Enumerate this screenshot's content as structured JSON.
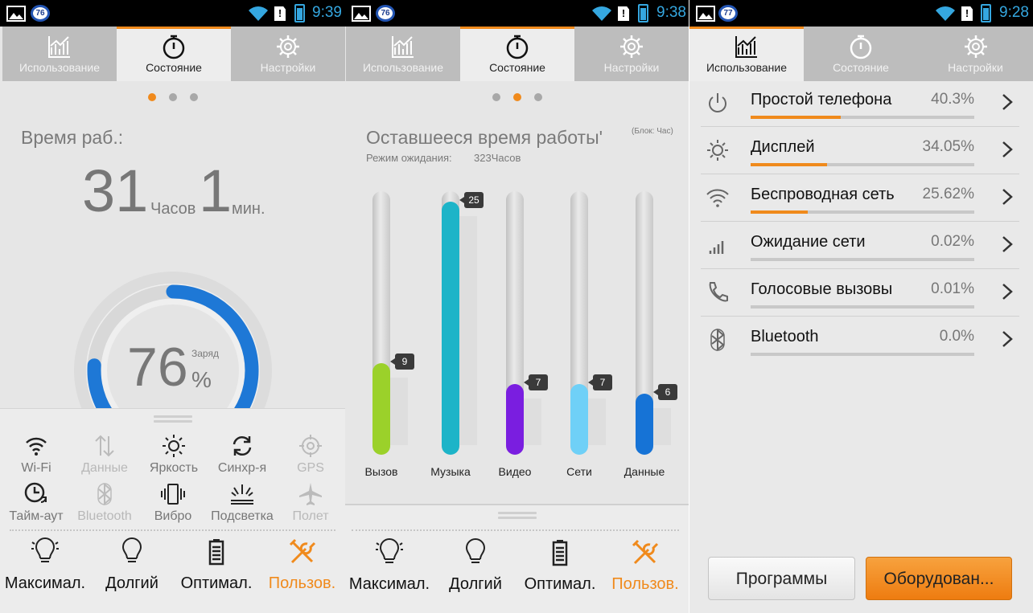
{
  "screens": [
    {
      "status": {
        "badge": "76",
        "time": "9:39"
      },
      "tabs": [
        "Использование",
        "Состояние",
        "Настройки"
      ],
      "active_tab": 1,
      "page_dots": {
        "count": 3,
        "active": 0
      },
      "uptime": {
        "label": "Время раб.:",
        "hours": "31",
        "hours_unit": "Часов",
        "minutes": "1",
        "minutes_unit": "мин."
      },
      "battery_gauge": {
        "percent": 76,
        "value": "76",
        "unit": "%",
        "label": "Заряд"
      },
      "quick_settings": [
        {
          "label": "Wi-Fi",
          "icon": "wifi-icon",
          "enabled": true
        },
        {
          "label": "Данные",
          "icon": "data-icon",
          "enabled": false
        },
        {
          "label": "Яркость",
          "icon": "brightness-icon",
          "enabled": true
        },
        {
          "label": "Синхр-я",
          "icon": "sync-icon",
          "enabled": true
        },
        {
          "label": "GPS",
          "icon": "gps-icon",
          "enabled": false
        },
        {
          "label": "Тайм-аут",
          "icon": "timeout-icon",
          "enabled": true
        },
        {
          "label": "Bluetooth",
          "icon": "bluetooth-icon",
          "enabled": false
        },
        {
          "label": "Вибро",
          "icon": "vibrate-icon",
          "enabled": true
        },
        {
          "label": "Подсветка",
          "icon": "backlight-icon",
          "enabled": true
        },
        {
          "label": "Полет",
          "icon": "airplane-icon",
          "enabled": false
        }
      ],
      "modes": [
        {
          "label": "Максимал.",
          "icon": "bulb-max-icon"
        },
        {
          "label": "Долгий",
          "icon": "bulb-icon"
        },
        {
          "label": "Оптимал.",
          "icon": "battery-icon"
        },
        {
          "label": "Пользов.",
          "icon": "tools-icon"
        }
      ],
      "selected_mode": 3
    },
    {
      "status": {
        "badge": "76",
        "time": "9:38"
      },
      "tabs": [
        "Использование",
        "Состояние",
        "Настройки"
      ],
      "active_tab": 1,
      "page_dots": {
        "count": 3,
        "active": 1
      },
      "title": "Оставшееся время работы'",
      "unit_note": "(Блок: Час)",
      "standby": {
        "label": "Режим ожидания:",
        "value": "323Часов"
      },
      "modes": [
        {
          "label": "Максимал.",
          "icon": "bulb-max-icon"
        },
        {
          "label": "Долгий",
          "icon": "bulb-icon"
        },
        {
          "label": "Оптимал.",
          "icon": "battery-icon"
        },
        {
          "label": "Пользов.",
          "icon": "tools-icon"
        }
      ],
      "selected_mode": 3
    },
    {
      "status": {
        "badge": "77",
        "time": "9:28"
      },
      "tabs": [
        "Использование",
        "Состояние",
        "Настройки"
      ],
      "active_tab": 0,
      "usage": [
        {
          "name": "Простой телефона",
          "percent": "40.3%",
          "fraction": 0.403,
          "icon": "power-icon"
        },
        {
          "name": "Дисплей",
          "percent": "34.05%",
          "fraction": 0.3405,
          "icon": "brightness-icon"
        },
        {
          "name": "Беспроводная сеть",
          "percent": "25.62%",
          "fraction": 0.2562,
          "icon": "wifi-icon"
        },
        {
          "name": "Ожидание сети",
          "percent": "0.02%",
          "fraction": 0.0002,
          "icon": "signal-icon"
        },
        {
          "name": "Голосовые вызовы",
          "percent": "0.01%",
          "fraction": 0.0001,
          "icon": "phone-icon"
        },
        {
          "name": "Bluetooth",
          "percent": "0.0%",
          "fraction": 0.0,
          "icon": "bluetooth-icon"
        }
      ],
      "buttons": {
        "apps": "Программы",
        "hardware": "Оборудован..."
      }
    }
  ],
  "chart_data": {
    "type": "bar",
    "categories": [
      "Вызов",
      "Музыка",
      "Видео",
      "Сети",
      "Данные"
    ],
    "values": [
      9,
      25,
      7,
      7,
      6
    ],
    "value_labels": [
      "9",
      "25",
      "7",
      "7",
      "6"
    ],
    "colors": [
      "#9bd12a",
      "#1db4c8",
      "#7a1ee0",
      "#6fd0f7",
      "#1673d6"
    ],
    "ylim": [
      0,
      26
    ]
  },
  "colors": {
    "accent": "#f08a1c",
    "blue": "#35a7e0",
    "gauge": "#1e78d6"
  }
}
